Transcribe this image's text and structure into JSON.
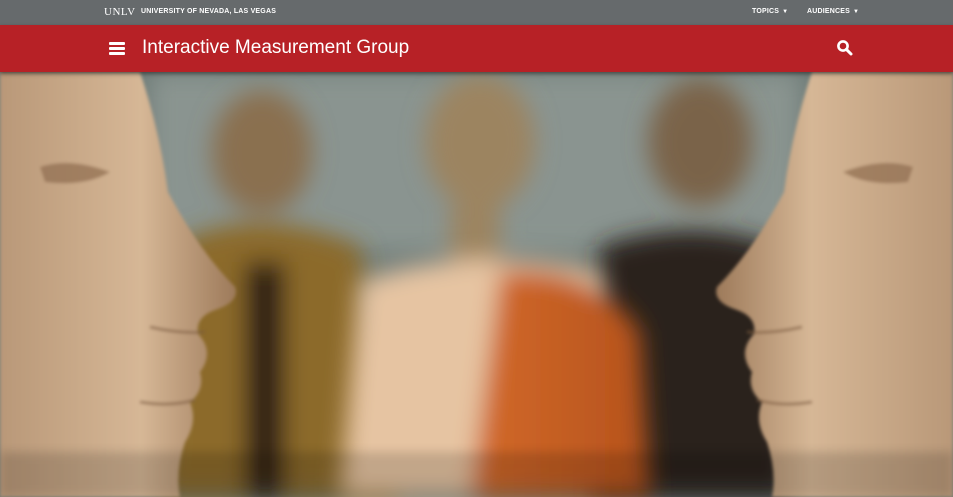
{
  "topbar": {
    "logo_text": "UNLV",
    "university_name": "UNIVERSITY OF NEVADA, LAS VEGAS",
    "nav": [
      {
        "label": "TOPICS"
      },
      {
        "label": "AUDIENCES"
      }
    ]
  },
  "header": {
    "site_title": "Interactive Measurement Group",
    "background_color": "#b72126",
    "menu_icon": "hamburger-menu-icon",
    "search_icon": "search-icon"
  },
  "hero": {
    "subject": "mannequins-photo"
  }
}
